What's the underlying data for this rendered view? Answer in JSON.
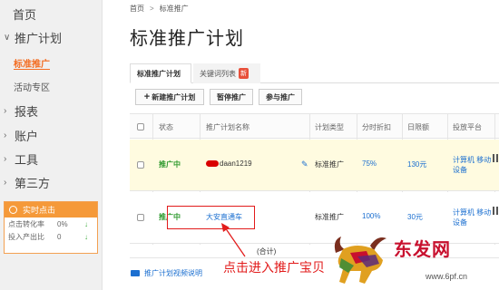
{
  "sidebar": {
    "home": "首页",
    "plan": "推广计划",
    "standard": "标准推广",
    "activity": "活动专区",
    "report": "报表",
    "account": "账户",
    "tools": "工具",
    "third": "第三方",
    "realtime": {
      "title": "实时点击",
      "rows": [
        {
          "label": "点击转化率",
          "value": "0%"
        },
        {
          "label": "投入产出比",
          "value": "0"
        }
      ]
    }
  },
  "breadcrumb": {
    "home": "首页",
    "current": "标准推广"
  },
  "page_title": "标准推广计划",
  "tabs": [
    {
      "label": "标准推广计划"
    },
    {
      "label": "关键词列表",
      "badge": "新"
    }
  ],
  "toolbar": {
    "new_plan": "新建推广计划",
    "pause": "暂停推广",
    "join": "参与推广"
  },
  "table": {
    "headers": {
      "status": "状态",
      "name": "推广计划名称",
      "type": "计划类型",
      "discount": "分时折扣",
      "budget": "日限额",
      "platform": "投放平台"
    },
    "rows": [
      {
        "status": "推广中",
        "name": "daan1219",
        "type": "标准推广",
        "discount": "75%",
        "budget": "130元",
        "platform": "计算机 移动设备"
      },
      {
        "status": "推广中",
        "name": "大安直通车",
        "type": "标准推广",
        "discount": "100%",
        "budget": "30元",
        "platform": "计算机 移动设备"
      }
    ],
    "total": "(合计)"
  },
  "video_link": "推广计划视频说明",
  "annotation": "点击进入推广宝贝",
  "watermark": {
    "brand": "东发网",
    "url": "www.6pf.cn"
  },
  "colors": {
    "accent": "#f36c21",
    "link": "#1b6fd0",
    "status": "#2f9a2f",
    "highlight": "#e21b1b"
  }
}
